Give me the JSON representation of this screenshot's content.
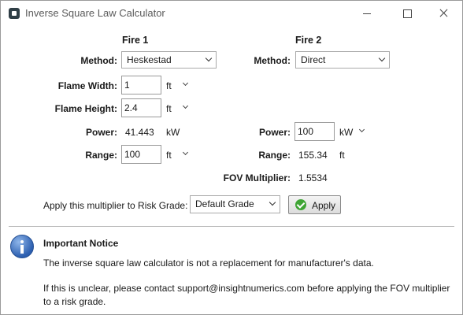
{
  "window": {
    "title": "Inverse Square Law Calculator"
  },
  "fire1": {
    "header": "Fire 1",
    "method_label": "Method:",
    "method_value": "Heskestad",
    "flame_width_label": "Flame Width:",
    "flame_width_value": "1",
    "flame_width_unit": "ft",
    "flame_height_label": "Flame Height:",
    "flame_height_value": "2.4",
    "flame_height_unit": "ft",
    "power_label": "Power:",
    "power_value": "41.443",
    "power_unit": "kW",
    "range_label": "Range:",
    "range_value": "100",
    "range_unit": "ft"
  },
  "fire2": {
    "header": "Fire 2",
    "method_label": "Method:",
    "method_value": "Direct",
    "power_label": "Power:",
    "power_value": "100",
    "power_unit": "kW",
    "range_label": "Range:",
    "range_value": "155.34",
    "range_unit": "ft",
    "fov_label": "FOV Multiplier:",
    "fov_value": "1.5534"
  },
  "apply_row": {
    "label": "Apply this multiplier to Risk Grade:",
    "grade_value": "Default Grade",
    "apply_button": "Apply"
  },
  "notice": {
    "title": "Important Notice",
    "line1": "The inverse square law calculator is not a replacement for manufacturer's data.",
    "line2": "If this is unclear, please contact support@insightnumerics.com before applying the FOV multiplier",
    "line3": "to a risk grade."
  },
  "colors": {
    "apply_icon": "#3fa535",
    "info_icon": "#2c5fb0"
  }
}
